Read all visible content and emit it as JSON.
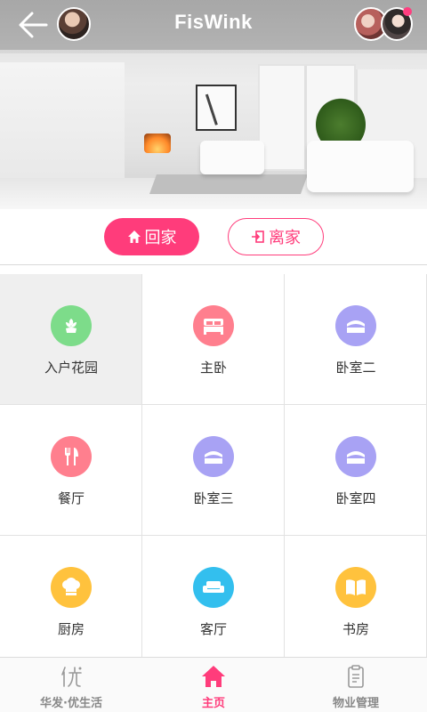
{
  "header": {
    "title": "FisWink"
  },
  "modes": {
    "home_label": "回家",
    "away_label": "离家"
  },
  "rooms": [
    {
      "label": "入户花园",
      "icon": "flower-icon",
      "color": "#7ddc8a"
    },
    {
      "label": "主卧",
      "icon": "bed-icon",
      "color": "#ff7f8e"
    },
    {
      "label": "卧室二",
      "icon": "bed-icon",
      "color": "#a8a2f4"
    },
    {
      "label": "餐厅",
      "icon": "fork-knife-icon",
      "color": "#ff7f8e"
    },
    {
      "label": "卧室三",
      "icon": "bed-icon",
      "color": "#a8a2f4"
    },
    {
      "label": "卧室四",
      "icon": "bed-icon",
      "color": "#a8a2f4"
    },
    {
      "label": "厨房",
      "icon": "chef-hat-icon",
      "color": "#ffc23d"
    },
    {
      "label": "客厅",
      "icon": "sofa-icon",
      "color": "#33bfee"
    },
    {
      "label": "书房",
      "icon": "book-icon",
      "color": "#ffc23d"
    }
  ],
  "bottom_nav": [
    {
      "label": "华发·优生活",
      "icon": "you-life-icon"
    },
    {
      "label": "主页",
      "icon": "home-icon"
    },
    {
      "label": "物业管理",
      "icon": "clipboard-icon"
    }
  ],
  "colors": {
    "accent": "#ff3c7b"
  }
}
